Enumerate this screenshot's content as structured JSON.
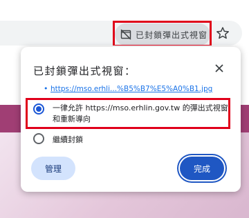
{
  "toolbar": {
    "blocked_chip_label": "已封鎖彈出式視窗",
    "blocked_chip_icon": "popup-blocked-icon",
    "star_icon": "star-outline-icon"
  },
  "popup": {
    "title": "已封鎖彈出式視窗：",
    "close_icon": "close-icon",
    "blocked_links": [
      {
        "text": "https://mso.erhli...%B5%B7%E5%A0%B1.jpg"
      }
    ],
    "options": {
      "allow_label": "一律允許 https://mso.erhlin.gov.tw 的彈出式視窗和重新導向",
      "allow_selected": true,
      "block_label": "繼續封鎖",
      "block_selected": false
    },
    "manage_label": "管理",
    "done_label": "完成"
  },
  "colors": {
    "accent": "#1f57c3",
    "link": "#1a73e8",
    "highlight": "#e0001a",
    "page_band": "#a03e74"
  }
}
